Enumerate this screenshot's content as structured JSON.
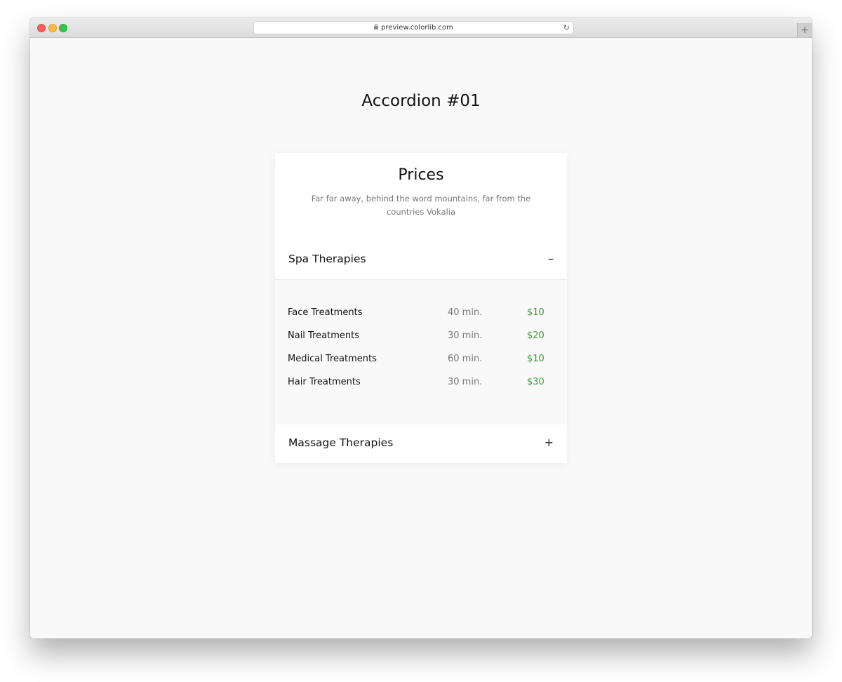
{
  "browser": {
    "url": "preview.colorlib.com",
    "new_tab": "+"
  },
  "page": {
    "title": "Accordion #01"
  },
  "card": {
    "title": "Prices",
    "subtitle": "Far far away, behind the word mountains, far from the countries Vokalia"
  },
  "accordion": [
    {
      "title": "Spa Therapies",
      "toggle": "–",
      "expanded": true,
      "items": [
        {
          "name": "Face Treatments",
          "duration": "40 min.",
          "price": "$10"
        },
        {
          "name": "Nail Treatments",
          "duration": "30 min.",
          "price": "$20"
        },
        {
          "name": "Medical Treatments",
          "duration": "60 min.",
          "price": "$10"
        },
        {
          "name": "Hair Treatments",
          "duration": "30 min.",
          "price": "$30"
        }
      ]
    },
    {
      "title": "Massage Therapies",
      "toggle": "+",
      "expanded": false
    }
  ],
  "colors": {
    "price_accent": "#3c9a3c",
    "page_background": "#f9f9f9"
  }
}
